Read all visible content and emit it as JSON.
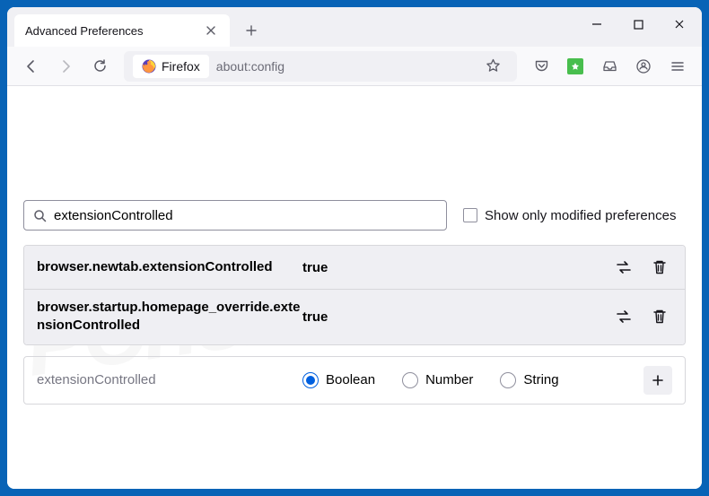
{
  "window": {
    "tab_title": "Advanced Preferences"
  },
  "urlbar": {
    "identity_label": "Firefox",
    "url": "about:config"
  },
  "search": {
    "value": "extensionControlled",
    "checkbox_label": "Show only modified preferences"
  },
  "prefs": [
    {
      "name": "browser.newtab.extensionControlled",
      "value": "true"
    },
    {
      "name": "browser.startup.homepage_override.extensionControlled",
      "value": "true"
    }
  ],
  "new_pref": {
    "name": "extensionControlled",
    "types": {
      "boolean": "Boolean",
      "number": "Number",
      "string": "String"
    },
    "selected": "boolean"
  },
  "watermark": "PCrisk.com"
}
